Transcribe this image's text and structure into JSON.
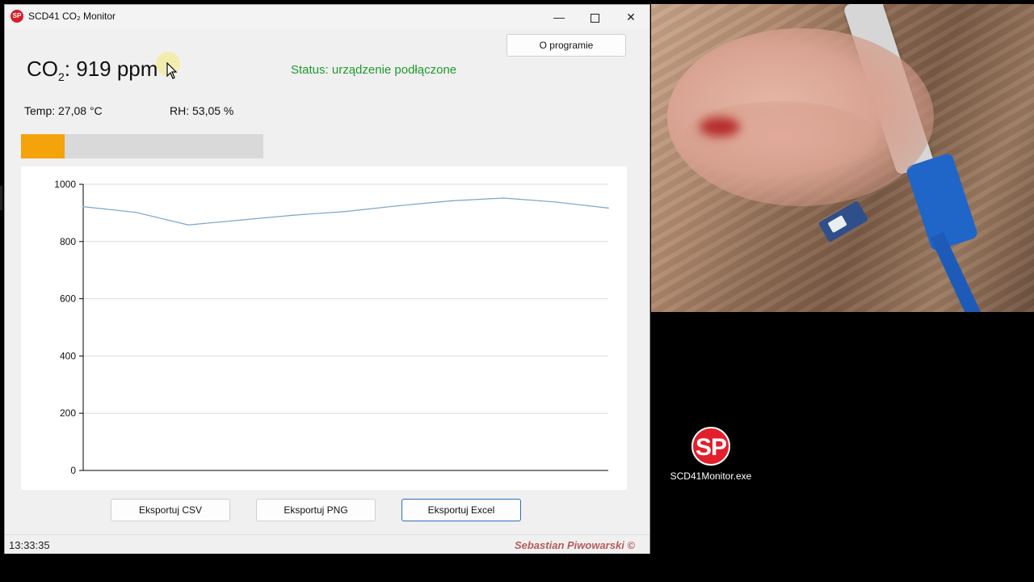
{
  "window": {
    "title": "SCD41 CO₂ Monitor",
    "icon_text": "SP",
    "controls": {
      "minimize": "—",
      "close": "✕"
    }
  },
  "header": {
    "about_button": "O programie",
    "co2_prefix": "CO",
    "co2_sub": "2",
    "co2_value_text": ": 919 ppm",
    "status": "Status: urządzenie podłączone",
    "temp": "Temp: 27,08 °C",
    "rh": "RH: 53,05 %",
    "co2_level_fraction": 0.18
  },
  "chart_data": {
    "type": "line",
    "title": "",
    "xlabel": "",
    "ylabel": "",
    "ylim": [
      0,
      1000
    ],
    "yticks": [
      0,
      200,
      400,
      600,
      800,
      1000
    ],
    "grid": true,
    "series": [
      {
        "values": [
          922,
          902,
          858,
          875,
          892,
          905,
          925,
          942,
          952,
          938,
          917
        ]
      }
    ],
    "colors": {
      "line": "#7aa6c6",
      "grid": "#dcdcdc",
      "axis": "#000000"
    }
  },
  "footer_buttons": {
    "csv": "Eksportuj CSV",
    "png": "Eksportuj PNG",
    "excel": "Eksportuj Excel"
  },
  "statusbar": {
    "time": "13:33:35",
    "author": "Sebastian Piwowarski ©"
  },
  "desktop": {
    "icon_label": "SCD41Monitor.exe",
    "icon_text": "SP"
  },
  "colors": {
    "status_ok": "#1e9a2c",
    "progress_fill": "#f4a30a",
    "accent": "#2b6fb8"
  }
}
